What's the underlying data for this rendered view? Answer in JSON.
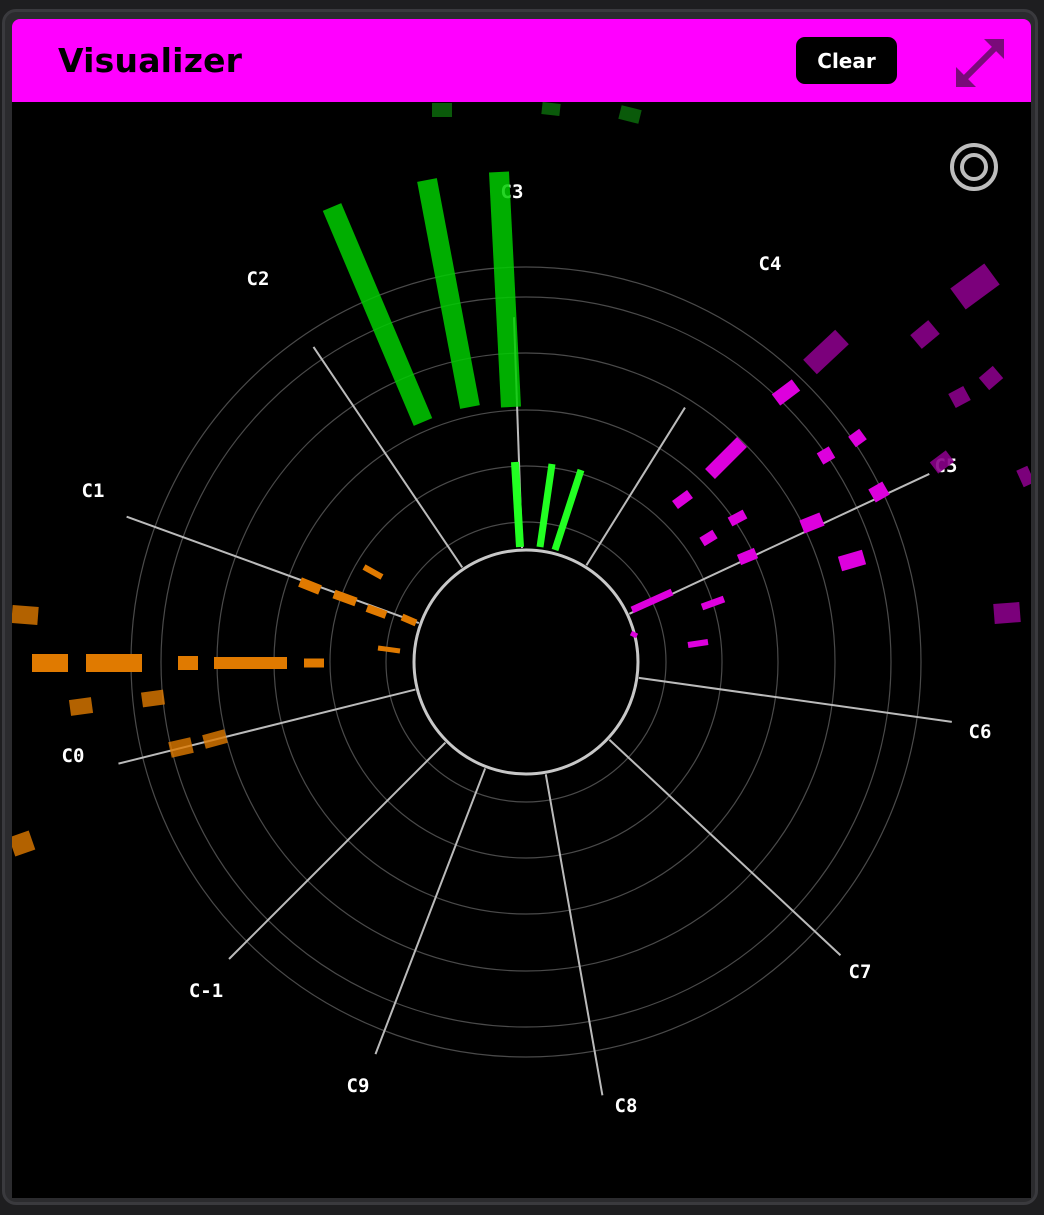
{
  "window": {
    "title": "Visualizer",
    "clear_label": "Clear",
    "header_color": "#ff00ff"
  },
  "icons": {
    "expand": "expand-diagonal-icon",
    "target": "target-rings-icon"
  },
  "visualizer": {
    "ring_count": 7,
    "spokes": [
      {
        "label": "C3",
        "angle_deg": -92,
        "color": "#66ff66"
      },
      {
        "label": "C4",
        "angle_deg": -58
      },
      {
        "label": "C5",
        "angle_deg": -25
      },
      {
        "label": "C6",
        "angle_deg": 8
      },
      {
        "label": "C7",
        "angle_deg": 43
      },
      {
        "label": "C8",
        "angle_deg": 80
      },
      {
        "label": "C9",
        "angle_deg": 111
      },
      {
        "label": "C-1",
        "angle_deg": 135
      },
      {
        "label": "C0",
        "angle_deg": 166
      },
      {
        "label": "C1",
        "angle_deg": -160
      },
      {
        "label": "C2",
        "angle_deg": -124
      }
    ],
    "colors": {
      "green": "#00cc00",
      "bright_green": "#22ff22",
      "orange": "#e07a00",
      "magenta": "#dd00dd",
      "dark_magenta": "#880088",
      "grid": "#4a4a4a",
      "spoke": "#bbbbbb"
    }
  }
}
